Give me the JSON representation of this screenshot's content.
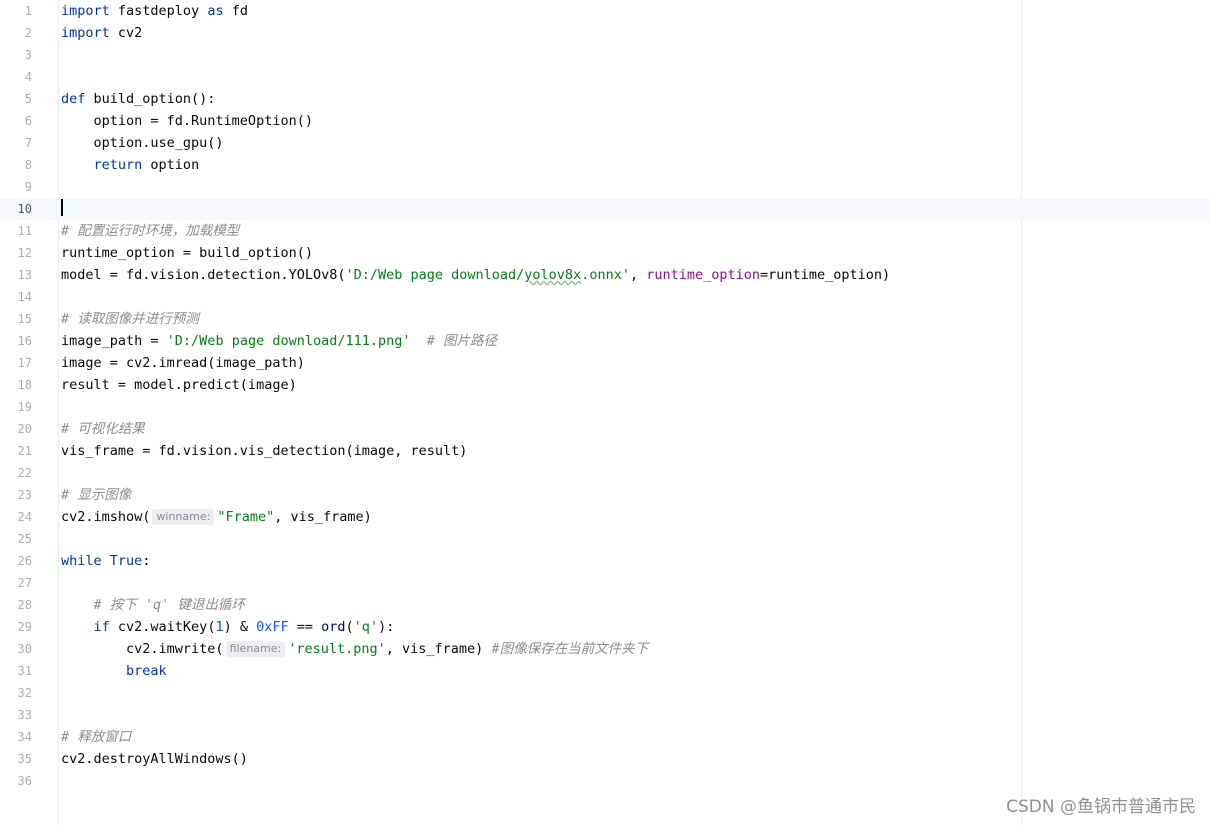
{
  "editor": {
    "current_line": 10,
    "lines": [
      [
        {
          "t": "kw",
          "v": "import"
        },
        {
          "t": "txt",
          "v": " fastdeploy "
        },
        {
          "t": "kw",
          "v": "as"
        },
        {
          "t": "txt",
          "v": " fd"
        }
      ],
      [
        {
          "t": "kw",
          "v": "import"
        },
        {
          "t": "txt",
          "v": " cv2"
        }
      ],
      [],
      [],
      [
        {
          "t": "kw",
          "v": "def"
        },
        {
          "t": "txt",
          "v": " build_option():"
        }
      ],
      [
        {
          "t": "txt",
          "v": "    option = fd.RuntimeOption()"
        }
      ],
      [
        {
          "t": "txt",
          "v": "    option.use_gpu()"
        }
      ],
      [
        {
          "t": "txt",
          "v": "    "
        },
        {
          "t": "kw",
          "v": "return"
        },
        {
          "t": "txt",
          "v": " option"
        }
      ],
      [],
      [
        {
          "t": "caret",
          "v": ""
        }
      ],
      [
        {
          "t": "comment",
          "v": "# 配置运行时环境，加载模型"
        }
      ],
      [
        {
          "t": "txt",
          "v": "runtime_option = build_option()"
        }
      ],
      [
        {
          "t": "txt",
          "v": "model = fd.vision.detection.YOLOv8("
        },
        {
          "t": "str",
          "v": "'D:/Web page download/"
        },
        {
          "t": "str-typo",
          "v": "yolov8x"
        },
        {
          "t": "str",
          "v": ".onnx'"
        },
        {
          "t": "txt",
          "v": ", "
        },
        {
          "t": "param",
          "v": "runtime_option"
        },
        {
          "t": "txt",
          "v": "=runtime_option)"
        }
      ],
      [],
      [
        {
          "t": "comment",
          "v": "# 读取图像并进行预测"
        }
      ],
      [
        {
          "t": "txt",
          "v": "image_path = "
        },
        {
          "t": "str",
          "v": "'D:/Web page download/111.png'"
        },
        {
          "t": "txt",
          "v": "  "
        },
        {
          "t": "comment",
          "v": "# 图片路径"
        }
      ],
      [
        {
          "t": "txt",
          "v": "image = cv2.imread(image_path)"
        }
      ],
      [
        {
          "t": "txt",
          "v": "result = model.predict(image)"
        }
      ],
      [],
      [
        {
          "t": "comment",
          "v": "# 可视化结果"
        }
      ],
      [
        {
          "t": "txt",
          "v": "vis_frame = fd.vision.vis_detection(image, result)"
        }
      ],
      [],
      [
        {
          "t": "comment",
          "v": "# 显示图像"
        }
      ],
      [
        {
          "t": "txt",
          "v": "cv2.imshow("
        },
        {
          "t": "hint",
          "v": "winname:"
        },
        {
          "t": "str",
          "v": "\"Frame\""
        },
        {
          "t": "txt",
          "v": ", vis_frame)"
        }
      ],
      [],
      [
        {
          "t": "kw",
          "v": "while"
        },
        {
          "t": "txt",
          "v": " "
        },
        {
          "t": "kw",
          "v": "True"
        },
        {
          "t": "txt",
          "v": ":"
        }
      ],
      [],
      [
        {
          "t": "txt",
          "v": "    "
        },
        {
          "t": "comment",
          "v": "# 按下 'q' 键退出循环"
        }
      ],
      [
        {
          "t": "txt",
          "v": "    "
        },
        {
          "t": "kw",
          "v": "if"
        },
        {
          "t": "txt",
          "v": " cv2.waitKey("
        },
        {
          "t": "num",
          "v": "1"
        },
        {
          "t": "txt",
          "v": ") & "
        },
        {
          "t": "num",
          "v": "0xFF"
        },
        {
          "t": "txt",
          "v": " == "
        },
        {
          "t": "builtin",
          "v": "ord"
        },
        {
          "t": "txt",
          "v": "("
        },
        {
          "t": "str",
          "v": "'q'"
        },
        {
          "t": "txt",
          "v": "):"
        }
      ],
      [
        {
          "t": "txt",
          "v": "        cv2.imwrite("
        },
        {
          "t": "hint",
          "v": "filename:"
        },
        {
          "t": "str",
          "v": "'result.png'"
        },
        {
          "t": "txt",
          "v": ", vis_frame) "
        },
        {
          "t": "comment",
          "v": "#图像保存在当前文件夹下"
        }
      ],
      [
        {
          "t": "txt",
          "v": "        "
        },
        {
          "t": "kw",
          "v": "break"
        }
      ],
      [],
      [],
      [
        {
          "t": "comment",
          "v": "# 释放窗口"
        }
      ],
      [
        {
          "t": "txt",
          "v": "cv2.destroyAllWindows()"
        }
      ],
      []
    ]
  },
  "watermark": "CSDN @鱼锅市普通市民",
  "colors": {
    "keyword": "#0033b3",
    "string": "#067d17",
    "number": "#1750eb",
    "parameter": "#871094",
    "comment": "#8c8c8c",
    "current_line_bg": "#f5f8fe"
  }
}
